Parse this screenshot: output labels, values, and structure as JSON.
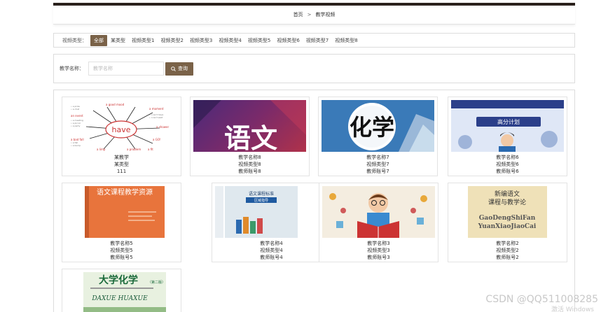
{
  "breadcrumb": {
    "home": "首页",
    "separator": ">",
    "current": "教学视频"
  },
  "filter": {
    "label": "视频类型：",
    "options": [
      "全部",
      "某类型",
      "视频类型1",
      "视频类型2",
      "视频类型3",
      "视频类型4",
      "视频类型5",
      "视频类型6",
      "视频类型7",
      "视频类型8"
    ],
    "active": "全部"
  },
  "search": {
    "label": "教学名称：",
    "placeholder": "教学名称",
    "value": "",
    "button_label": "查询"
  },
  "cards": [
    {
      "name": "某教学",
      "type": "某类型",
      "account": "111",
      "image": "have-mindmap"
    },
    {
      "name": "教学名称8",
      "type": "视频类型8",
      "account": "教师账号8",
      "image": "yuwen-poster"
    },
    {
      "name": "教学名称7",
      "type": "视频类型7",
      "account": "教师账号7",
      "image": "huaxue-poster"
    },
    {
      "name": "教学名称6",
      "type": "视频类型6",
      "account": "教师账号6",
      "image": "plan-poster"
    },
    {
      "name": "教学名称5",
      "type": "视频类型5",
      "account": "教师账号5",
      "image": "book-orange"
    },
    {
      "name": "教学名称4",
      "type": "视频类型4",
      "account": "教师账号4",
      "image": "book-grey"
    },
    {
      "name": "教学名称3",
      "type": "视频类型3",
      "account": "教师账号3",
      "image": "reading-boy"
    },
    {
      "name": "教学名称2",
      "type": "视频类型2",
      "account": "教师账号2",
      "image": "book-yellow"
    },
    {
      "name": "",
      "type": "",
      "account": "",
      "image": "daxue-huaxue"
    }
  ],
  "images": {
    "have_word": "have",
    "yuwen_chars": "语文",
    "huaxue_chars": "化学",
    "plan_text": "高分计划",
    "book_orange_title": "语文课程教学资源",
    "book_grey_title": "语文课程标准",
    "book_grey_sub": "区域指导",
    "book_yellow_title1": "新编语文",
    "book_yellow_title2": "课程与教学论",
    "book_yellow_pinyin1": "GaoDengShiFan",
    "book_yellow_pinyin2": "YuanXiaoJiaoCai",
    "daxue_title": "大学化学",
    "daxue_edition": "（第二版）",
    "daxue_pinyin": "DAXUE HUAXUE"
  },
  "watermark": {
    "text": "CSDN @QQ511008285",
    "sub": "激活 Windows"
  }
}
